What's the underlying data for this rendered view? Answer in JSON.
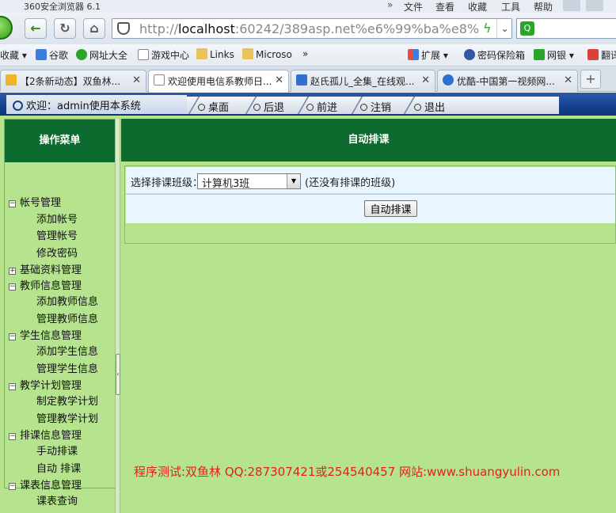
{
  "browser": {
    "title": "360安全浏览器 6.1",
    "menu": [
      "文件",
      "查看",
      "收藏",
      "工具",
      "帮助"
    ],
    "address": {
      "host": "localhost",
      "rest": ":60242/389asp.net%e6%99%ba%e8%83%b"
    },
    "favorites": [
      {
        "label": "收藏",
        "icon": "chevron-down-icon"
      },
      {
        "label": "谷歌",
        "icon": "google-icon"
      },
      {
        "label": "网址大全",
        "icon": "360-icon"
      },
      {
        "label": "游戏中心",
        "icon": "page-icon"
      },
      {
        "label": "Links",
        "icon": "folder-icon"
      },
      {
        "label": "Microso",
        "icon": "folder-icon"
      },
      {
        "label": "»",
        "icon": ""
      }
    ],
    "tools": [
      {
        "label": "扩展",
        "icon": "puzzle-icon"
      },
      {
        "label": "密码保险箱",
        "icon": "key-icon"
      },
      {
        "label": "网银",
        "icon": "shield-icon"
      },
      {
        "label": "翻译",
        "icon": "translate-icon"
      }
    ],
    "tabs": [
      {
        "label": "【2条新动态】双鱼林...",
        "icon": "star-icon",
        "active": false
      },
      {
        "label": "欢迎使用电信系教师日...",
        "icon": "page-icon",
        "active": true
      },
      {
        "label": "赵氏孤儿_全集_在线观...",
        "icon": "soku-icon",
        "active": false
      },
      {
        "label": "优酷-中国第一视频网...",
        "icon": "youku-icon",
        "active": false
      }
    ]
  },
  "app": {
    "welcome": "欢迎：admin使用本系统",
    "topnav": [
      "桌面",
      "后退",
      "前进",
      "注销",
      "退出"
    ],
    "sidebar": {
      "title": "操作菜单",
      "groups": [
        {
          "label": "帐号管理",
          "expanded": true,
          "items": [
            "添加帐号",
            "管理帐号",
            "修改密码"
          ]
        },
        {
          "label": "基础资料管理",
          "expanded": false,
          "items": []
        },
        {
          "label": "教师信息管理",
          "expanded": true,
          "items": [
            "添加教师信息",
            "管理教师信息"
          ]
        },
        {
          "label": "学生信息管理",
          "expanded": true,
          "items": [
            "添加学生信息",
            "管理学生信息"
          ]
        },
        {
          "label": "教学计划管理",
          "expanded": true,
          "items": [
            "制定教学计划",
            "管理教学计划"
          ]
        },
        {
          "label": "排课信息管理",
          "expanded": true,
          "items": [
            "手动排课",
            "自动 排课"
          ]
        },
        {
          "label": "课表信息管理",
          "expanded": true,
          "items": [
            "课表查询"
          ]
        }
      ]
    },
    "main": {
      "title": "自动排课",
      "select_label": "选择排课班级：",
      "selected_class": "计算机3班",
      "note": "(还没有排课的班级)",
      "button": "自动排课"
    },
    "footer": "程序测试:双鱼林 QQ:287307421或254540457 网站:www.shuangyulin.com"
  },
  "colors": {
    "page_bg": "#b5e38e",
    "header_green": "#0e6b2f",
    "topbar_blue": "#164190",
    "footer_red": "#e0231c"
  }
}
